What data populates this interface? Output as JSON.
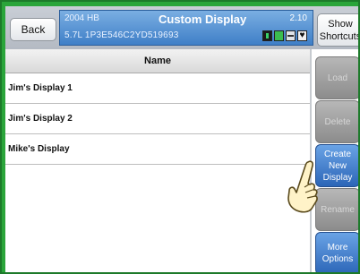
{
  "header": {
    "back_label": "Back",
    "show_shortcuts_label": "Show Shortcuts",
    "vehicle_year_model": "2004 HB",
    "title": "Custom Display",
    "version": "2.10",
    "engine_vin": "5.7L  1P3E546C2YD519693",
    "status_icons": [
      "battery-icon",
      "connection-icon",
      "signal-icon",
      "heart-icon"
    ]
  },
  "table": {
    "column_header": "Name",
    "rows": [
      {
        "name": "Jim's Display 1"
      },
      {
        "name": "Jim's Display 2"
      },
      {
        "name": "Mike's Display"
      }
    ]
  },
  "side_buttons": {
    "load": "Load",
    "delete": "Delete",
    "create_new_display": "Create New Display",
    "rename": "Rename",
    "more_options": "More Options"
  },
  "colors": {
    "frame_green": "#2aa53a",
    "title_blue": "#3f7fc7",
    "enabled_blue": "#2c66b8",
    "disabled_gray": "#8c8c8c"
  },
  "pointer": "hand-pointer-icon"
}
